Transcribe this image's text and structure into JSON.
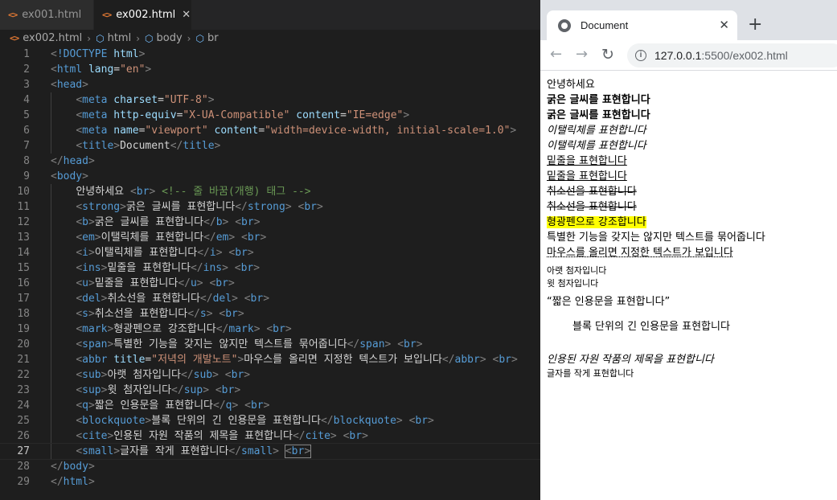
{
  "editor": {
    "tabs": [
      {
        "icon": "<>",
        "label": "ex001.html"
      },
      {
        "icon": "<>",
        "label": "ex002.html",
        "close": "✕"
      }
    ],
    "breadcrumb": {
      "file": "ex002.html",
      "items": [
        "html",
        "body",
        "br"
      ]
    },
    "current_line": 27
  },
  "browser": {
    "tab_title": "Document",
    "tab_close": "✕",
    "new_tab": "+",
    "back": "←",
    "forward": "→",
    "reload": "↻",
    "url_host": "127.0.0.1",
    "url_rest": ":5500/ex002.html",
    "content": {
      "plain": "안녕하세요",
      "strong": "굵은 글씨를 표현합니다",
      "b": "굵은 글씨를 표현합니다",
      "em": "이탤릭체를 표현합니다",
      "i": "이탤릭체를 표현합니다",
      "ins": "밑줄을 표현합니다",
      "u": "밑줄을 표현합니다",
      "del": "취소선을 표현합니다",
      "s": "취소선을 표현합니다",
      "mark": "형광펜으로 강조합니다",
      "span": "특별한 기능을 갖지는 않지만 텍스트를 묶어줍니다",
      "abbr": "마우스를 올리면 지정한 텍스트가 보입니다",
      "sub": "아랫 첨자입니다",
      "sup": "윗 첨자입니다",
      "q": "“짧은 인용문을 표현합니다”",
      "blockquote": "블록 단위의 긴 인용문을 표현합니다",
      "cite": "인용된 자원 작품의 제목을 표현합니다",
      "small": "글자를 작게 표현합니다"
    }
  }
}
